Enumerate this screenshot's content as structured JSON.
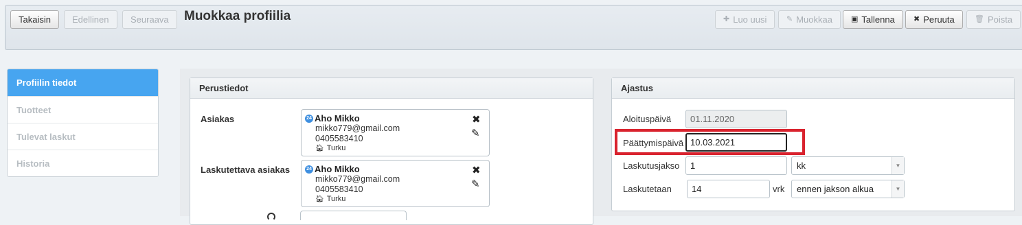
{
  "toolbar": {
    "back_label": "Takaisin",
    "prev_label": "Edellinen",
    "next_label": "Seuraava",
    "title": "Muokkaa profiilia",
    "new_label": "Luo uusi",
    "edit_label": "Muokkaa",
    "save_label": "Tallenna",
    "cancel_label": "Peruuta",
    "delete_label": "Poista"
  },
  "sidebar": {
    "items": [
      {
        "label": "Profiilin tiedot",
        "active": true
      },
      {
        "label": "Tuotteet",
        "active": false
      },
      {
        "label": "Tulevat laskut",
        "active": false
      },
      {
        "label": "Historia",
        "active": false
      }
    ]
  },
  "basic": {
    "heading": "Perustiedot",
    "customer_label": "Asiakas",
    "billed_customer_label": "Laskutettava asiakas",
    "customer": {
      "badge": "24",
      "name": "Aho Mikko",
      "email": "mikko779@gmail.com",
      "phone": "0405583410",
      "city": "Turku"
    },
    "billed_customer": {
      "badge": "24",
      "name": "Aho Mikko",
      "email": "mikko779@gmail.com",
      "phone": "0405583410",
      "city": "Turku"
    }
  },
  "schedule": {
    "heading": "Ajastus",
    "start_label": "Aloituspäivä",
    "start_value": "01.11.2020",
    "end_label": "Päättymispäivä",
    "end_value": "10.03.2021",
    "period_label": "Laskutusjakso",
    "period_value": "1",
    "period_unit": "kk",
    "invoiced_label": "Laskutetaan",
    "invoiced_value": "14",
    "invoiced_unit": "vrk",
    "invoiced_when": "ennen jakson alkua"
  },
  "colors": {
    "accent": "#47a5f0",
    "highlight": "#d9232e"
  }
}
